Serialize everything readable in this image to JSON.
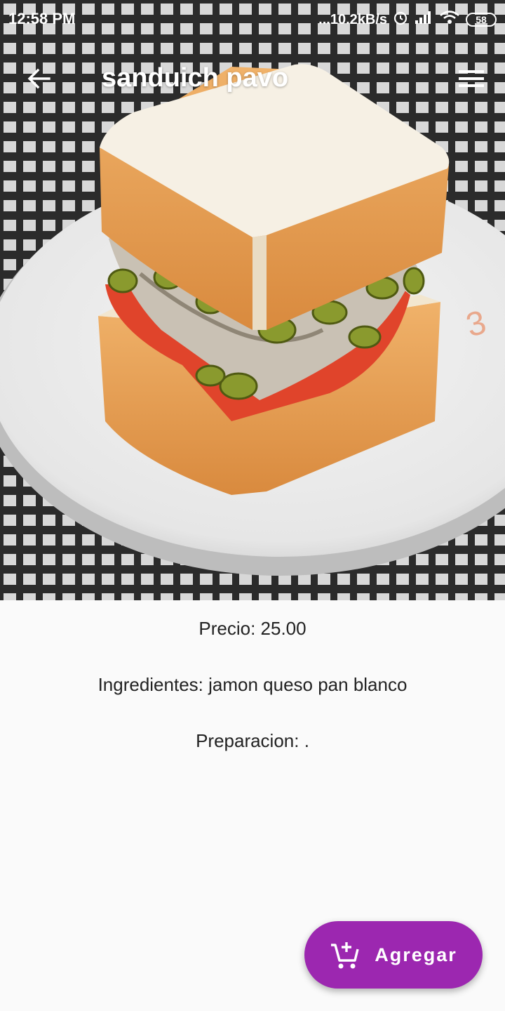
{
  "status_bar": {
    "time": "12:58 PM",
    "net_speed": "...10.2kB/s",
    "battery": "58"
  },
  "app_bar": {
    "title": "sanduich pavo",
    "back_icon": "arrow-back-icon",
    "menu_icon": "menu-icon"
  },
  "product": {
    "image_icon": "sandwich-photo",
    "price_text": "Precio: 25.00",
    "ingredients_text": "Ingredientes: jamon queso pan blanco",
    "preparation_text": "Preparacion: ."
  },
  "fab": {
    "label": "Agregar",
    "icon": "add-shopping-cart-icon"
  },
  "colors": {
    "accent": "#9c27b0",
    "background": "#fafafa",
    "text": "#222222"
  }
}
